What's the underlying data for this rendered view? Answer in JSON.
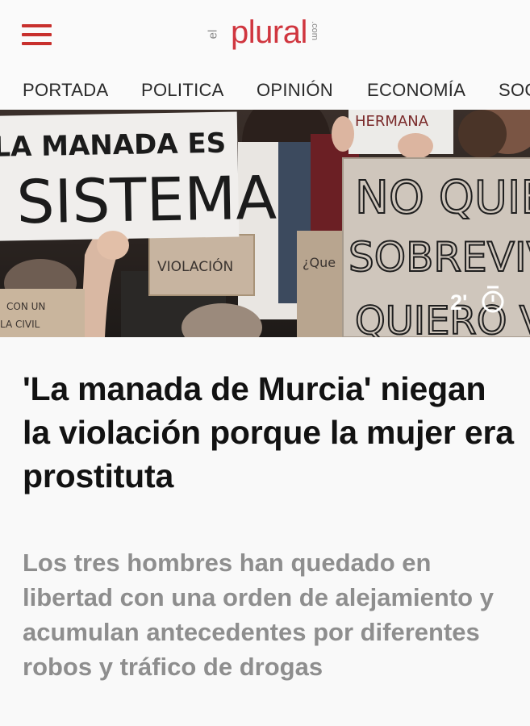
{
  "header": {
    "menu_icon": "hamburger-menu-icon",
    "logo": {
      "prefix": "el",
      "name": "plural",
      "suffix": ".com"
    },
    "accent_color": "#c8302d"
  },
  "nav": {
    "items": [
      {
        "label": "PORTADA"
      },
      {
        "label": "POLITICA"
      },
      {
        "label": "OPINIÓN"
      },
      {
        "label": "ECONOMÍA"
      },
      {
        "label": "SOC"
      }
    ]
  },
  "hero": {
    "signs": {
      "left_line1": "LA MANADA ES",
      "left_line2": "SISTEMA",
      "middle": "VIOLACIÓN",
      "middle_small": "¿Que",
      "bottom_left": "CON UN",
      "bottom_left2": "LA CIVIL",
      "top_right": "HERMANA",
      "right_line1": "NO QUIERO",
      "right_line2": "SOBREVIVIR",
      "right_line3": "QUIERO VIVIR"
    },
    "read_time": "2'",
    "read_time_icon": "stopwatch-icon"
  },
  "article": {
    "headline": "'La manada de Murcia' niegan la violación porque la mujer era prostituta",
    "subtitle": "Los tres hombres han quedado en libertad con una orden de alejamiento y acumulan antecedentes por diferentes robos y tráfico de drogas"
  }
}
